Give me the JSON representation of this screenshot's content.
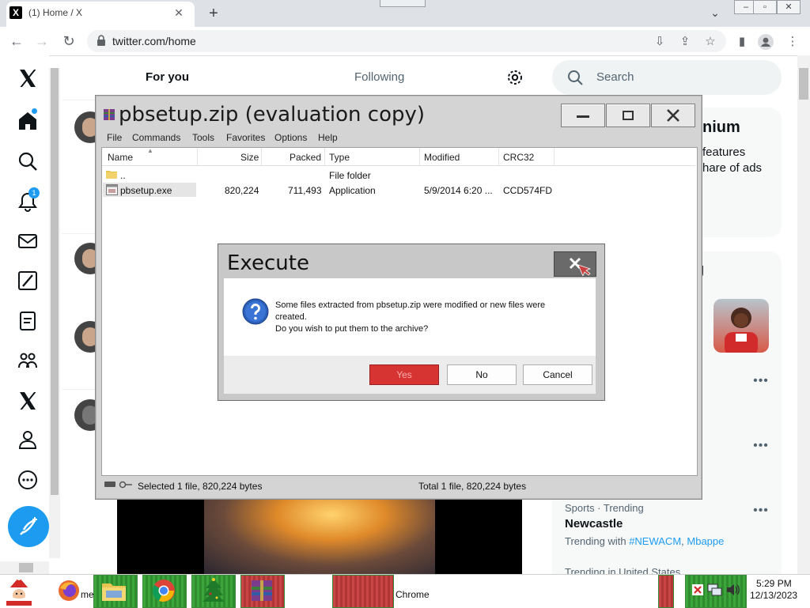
{
  "browser": {
    "tab_title": "(1) Home / X",
    "new_tab": "+",
    "close": "✕",
    "url": "twitter.com/home",
    "win_min": "–",
    "win_max": "▫",
    "win_close": "✕"
  },
  "twitter": {
    "tabs": [
      "For you",
      "Following"
    ],
    "notification_count": "1",
    "search_placeholder": "Search",
    "premium_title": "nium",
    "premium_line1": "features",
    "premium_line2": "hare of ads",
    "trending_heading_partial": "g",
    "trending_sub_partial": "o",
    "trend": {
      "meta": "Sports · Trending",
      "name": "Newcastle",
      "with_label": "Trending with",
      "tags": [
        "#NEWACM",
        "Mbappe"
      ],
      "next_meta": "Trending in United States"
    },
    "more_dots": "•••"
  },
  "winrar": {
    "title": "pbsetup.zip (evaluation copy)",
    "menu": [
      "File",
      "Commands",
      "Tools",
      "Favorites",
      "Options",
      "Help"
    ],
    "columns": [
      "Name",
      "Size",
      "Packed",
      "Type",
      "Modified",
      "CRC32"
    ],
    "rows": [
      {
        "name": "..",
        "size": "",
        "packed": "",
        "type": "File folder",
        "modified": "",
        "crc": ""
      },
      {
        "name": "pbsetup.exe",
        "size": "820,224",
        "packed": "711,493",
        "type": "Application",
        "modified": "5/9/2014 6:20 ...",
        "crc": "CCD574FD"
      }
    ],
    "status_left": "Selected 1 file, 820,224 bytes",
    "status_right": "Total 1 file, 820,224 bytes"
  },
  "dialog": {
    "title": "Execute",
    "line1": "Some files extracted from pbsetup.zip were modified or new files were",
    "line2": "created.",
    "line3": "Do you wish to put them to the archive?",
    "yes": "Yes",
    "no": "No",
    "cancel": "Cancel"
  },
  "taskbar": {
    "partial_label": "me",
    "chrome_label": "Chrome",
    "time": "5:29 PM",
    "date": "12/13/2023"
  },
  "colors": {
    "twitter_blue": "#1d9bf0",
    "yes_red": "#d63333",
    "taskbar_green": "#3ca53c",
    "taskbar_red": "#c84646"
  }
}
